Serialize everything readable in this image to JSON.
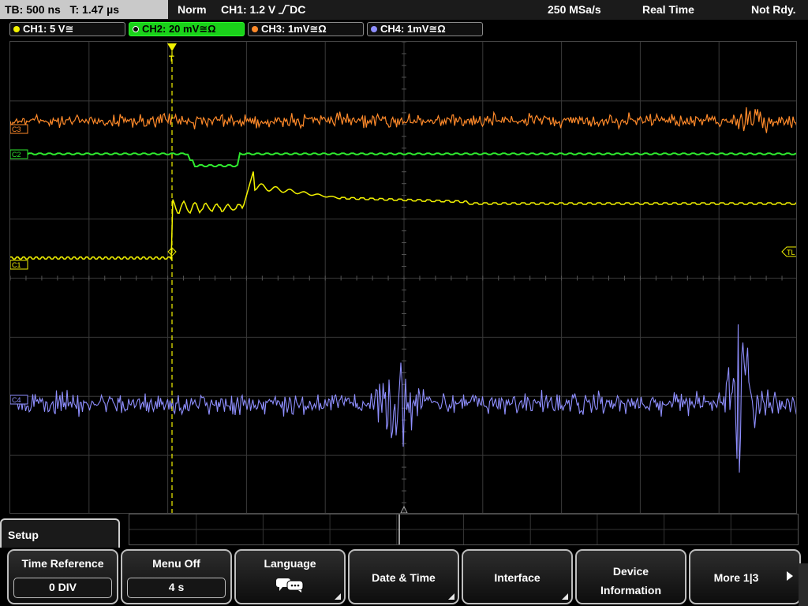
{
  "status": {
    "timebase": "TB: 500 ns",
    "trigger_time": "T: 1.47 µs",
    "trigger_mode": "Norm",
    "trigger_source": "CH1: 1.2 V",
    "trigger_coupling": "DC",
    "sample_rate": "250 MSa/s",
    "acq_mode": "Real Time",
    "state": "Not Rdy."
  },
  "channels": [
    {
      "label": "CH1: 5 V≅",
      "color": "#f2f200",
      "active": false
    },
    {
      "label": "CH2: 20 mV≅Ω",
      "color": "#33e833",
      "active": true
    },
    {
      "label": "CH3: 1mV≅Ω",
      "color": "#ff8a2a",
      "active": false
    },
    {
      "label": "CH4: 1mV≅Ω",
      "color": "#8f8fff",
      "active": false
    }
  ],
  "markers": {
    "c3": "C3",
    "c2": "C2",
    "c1": "C1",
    "c4": "C4",
    "tl": "TL",
    "trigger": "T"
  },
  "menu": {
    "title": "Setup",
    "time_reference": {
      "label": "Time Reference",
      "value": "0 DIV"
    },
    "menu_off": {
      "label": "Menu Off",
      "value": "4 s"
    },
    "language": {
      "label": "Language"
    },
    "date_time": {
      "label": "Date & Time"
    },
    "interface": {
      "label": "Interface"
    },
    "device_info": {
      "label_line1": "Device",
      "label_line2": "Information"
    },
    "more": {
      "label": "More 1|3"
    }
  },
  "icons": {
    "trigger_slope": "rising-edge-icon",
    "language": "speech-bubbles-icon",
    "submenu": "corner-triangle-icon",
    "next_page": "right-arrow-icon"
  }
}
